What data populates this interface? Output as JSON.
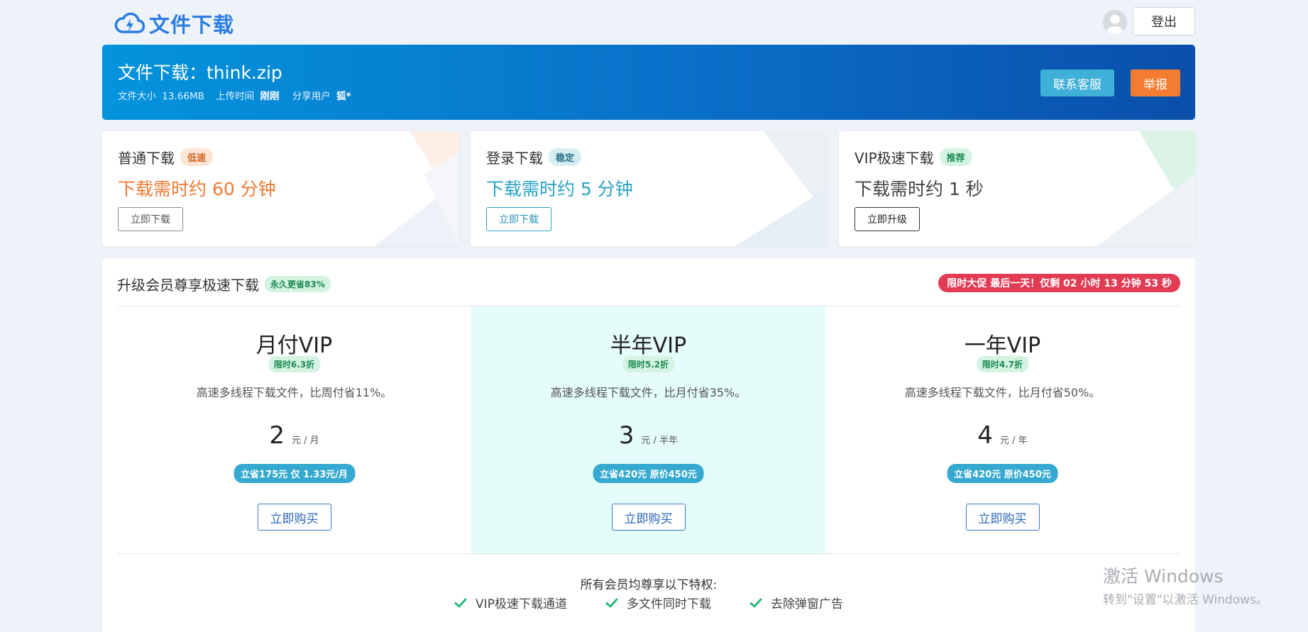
{
  "header": {
    "logo_text": "文件下载",
    "logout_label": "登出",
    "colors": {
      "brand": "#2a7de1"
    }
  },
  "banner": {
    "title": "文件下载：think.zip",
    "size_label": "文件大小",
    "size_value": "13.66MB",
    "upload_label": "上传时间",
    "upload_value": "刚刚",
    "sharer_label": "分享用户",
    "sharer_value": "狐*",
    "contact_label": "联系客服",
    "report_label": "举报",
    "colors": {
      "contact": "#3fb0d8",
      "report": "#f27d32"
    }
  },
  "speed_cards": [
    {
      "title": "普通下载",
      "tag": "低速",
      "time": "下载需时约 60 分钟",
      "button": "立即下载",
      "color": "#f07a33"
    },
    {
      "title": "登录下载",
      "tag": "稳定",
      "time": "下载需时约 5 分钟",
      "button": "立即下载",
      "color": "#2aa2c6"
    },
    {
      "title": "VIP极速下载",
      "tag": "推荐",
      "time": "下载需时约 1 秒",
      "button": "立即升级",
      "color": "#444444"
    }
  ],
  "membership": {
    "title": "升级会员尊享极速下载",
    "save_tag": "永久更省83%",
    "promo": "限时大促 最后一天！仅剩 02 小时 13 分钟 53 秒",
    "plans": [
      {
        "name": "月付VIP",
        "discount": "限时6.3折",
        "desc": "高速多线程下载文件，比周付省11%。",
        "price": "2",
        "unit": "元 / 月",
        "save": "立省175元 仅 1.33元/月",
        "buy": "立即购买"
      },
      {
        "name": "半年VIP",
        "discount": "限时5.2折",
        "desc": "高速多线程下载文件，比月付省35%。",
        "price": "3",
        "unit": "元 / 半年",
        "save": "立省420元 原价450元",
        "buy": "立即购买"
      },
      {
        "name": "一年VIP",
        "discount": "限时4.7折",
        "desc": "高速多线程下载文件，比月付省50%。",
        "price": "4",
        "unit": "元 / 年",
        "save": "立省420元 原价450元",
        "buy": "立即购买"
      }
    ],
    "perks_title": "所有会员均尊享以下特权:",
    "perks": [
      "VIP极速下载通道",
      "多文件同时下载",
      "去除弹窗广告"
    ]
  },
  "watermark": {
    "line1": "激活 Windows",
    "line2": "转到\"设置\"以激活 Windows。"
  }
}
